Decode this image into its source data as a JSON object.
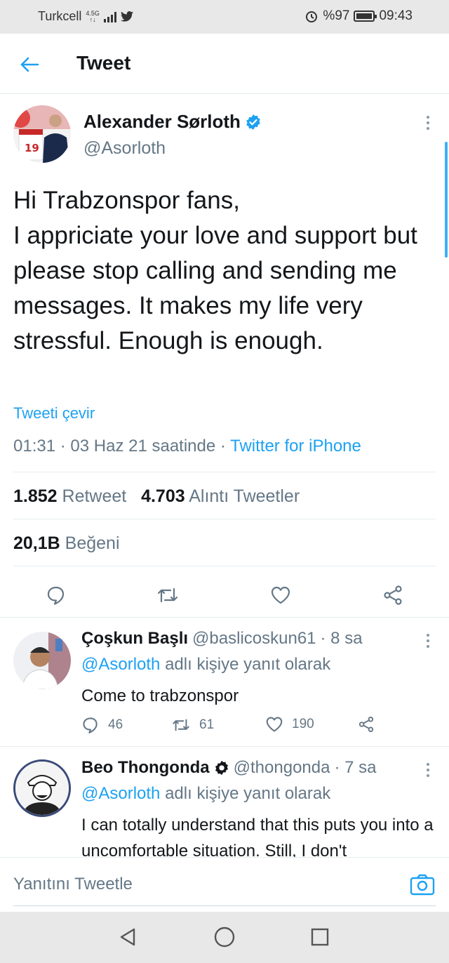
{
  "status_bar": {
    "carrier": "Turkcell",
    "network_top": "4.5G",
    "network_bottom": "↑↓",
    "battery": "%97",
    "time": "09:43"
  },
  "header": {
    "title": "Tweet"
  },
  "tweet": {
    "author_name": "Alexander Sørloth",
    "author_handle": "@Asorloth",
    "text": "Hi Trabzonspor fans,\nI appriciate your love and support but please stop calling and sending me messages. It makes my life very stressful. Enough is enough.",
    "translate": "Tweeti çevir",
    "time": "01:31",
    "date": "03 Haz 21 saatinde",
    "sep": "·",
    "source": "Twitter for iPhone",
    "retweets": "1.852",
    "retweets_label": "Retweet",
    "quotes": "4.703",
    "quotes_label": "Alıntı Tweetler",
    "likes": "20,1B",
    "likes_label": "Beğeni"
  },
  "replies": [
    {
      "name": "Çoşkun Başlı",
      "handle": "@baslicoskun61",
      "time": "· 8 sa",
      "replying_to": "@Asorloth",
      "replying_suffix": "adlı kişiye yanıt olarak",
      "text": "Come to trabzonspor",
      "reply_count": "46",
      "retweet_count": "61",
      "like_count": "190"
    },
    {
      "name": "Beo Thongonda",
      "handle": "@thongonda",
      "time": "· 7 sa",
      "replying_to": "@Asorloth",
      "replying_suffix": "adlı kişiye yanıt olarak",
      "text": "I can totally understand that this puts you into a uncomfortable situation. Still, I don't"
    }
  ],
  "compose": {
    "placeholder": "Yanıtını Tweetle"
  },
  "colors": {
    "accent": "#1da1f2",
    "secondary_text": "#657786",
    "divider": "#e6ecf0"
  }
}
